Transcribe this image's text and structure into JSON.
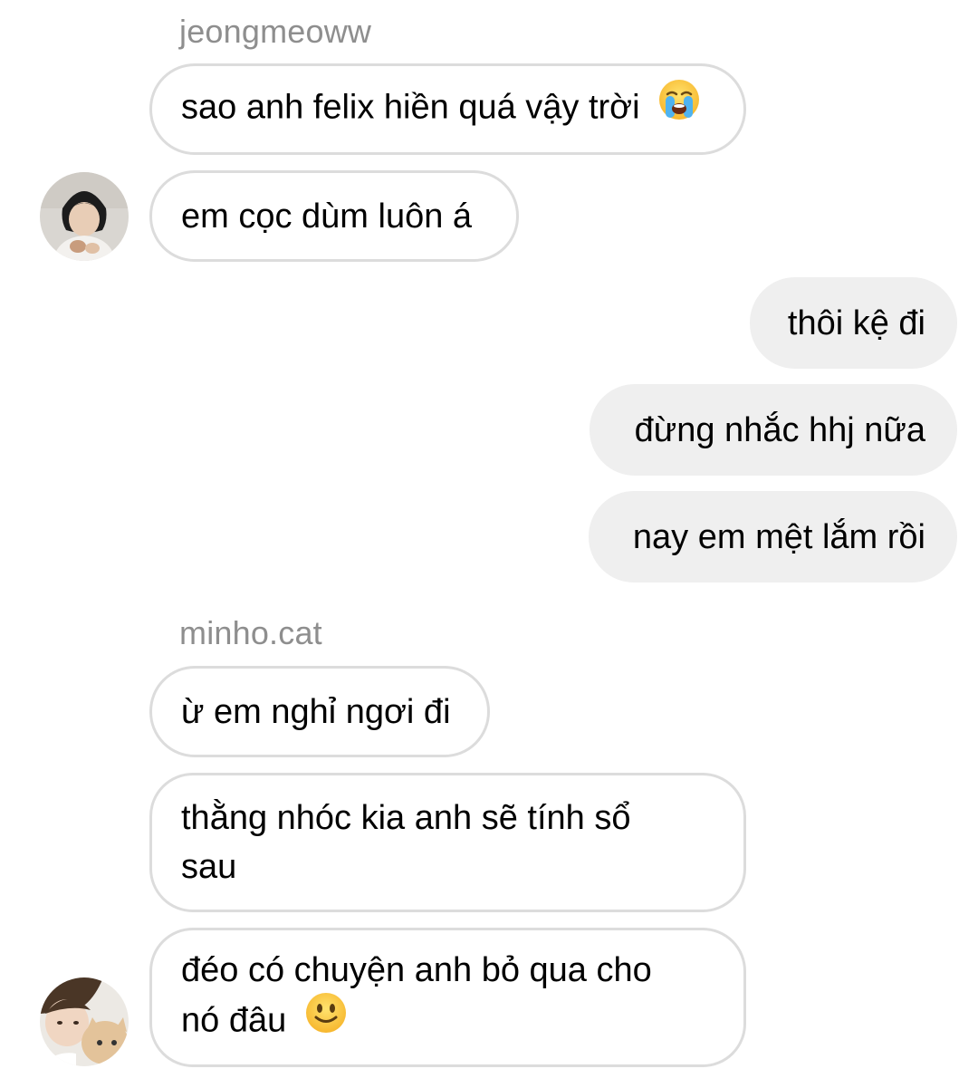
{
  "conversation": {
    "group1": {
      "sender": "jeongmeoww",
      "messages": [
        {
          "text": "sao anh felix hiền quá vậy trời",
          "emoji": "loudly-crying-face-emoji"
        },
        {
          "text": "em cọc dùm luôn á"
        }
      ]
    },
    "outgoing": [
      {
        "text": "thôi kệ đi"
      },
      {
        "text": "đừng nhắc hhj nữa"
      },
      {
        "text": "nay em mệt lắm rồi"
      }
    ],
    "group2": {
      "sender": "minho.cat",
      "messages": [
        {
          "text": "ừ em nghỉ ngơi đi"
        },
        {
          "line1": "thằng nhóc kia anh sẽ tính sổ",
          "line2": "sau"
        },
        {
          "line1": "đéo có chuyện anh bỏ qua cho",
          "line2": "nó đâu",
          "emoji": "slightly-smiling-face-emoji"
        }
      ]
    }
  },
  "colors": {
    "incoming_border": "#dcdcdc",
    "outgoing_bg": "#efefef",
    "sender_label": "#8e8e8e"
  }
}
